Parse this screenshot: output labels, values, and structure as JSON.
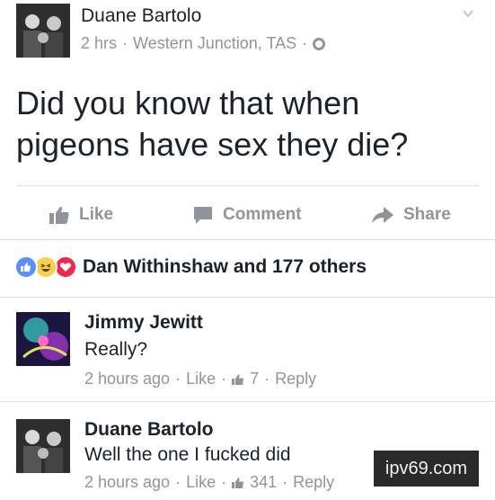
{
  "post": {
    "author": "Duane Bartolo",
    "time": "2 hrs",
    "location": "Western Junction, TAS",
    "sep": "·",
    "text_line1": "Did you know that when",
    "text_line2": "pigeons have sex they die?"
  },
  "actions": {
    "like": "Like",
    "comment": "Comment",
    "share": "Share"
  },
  "reactions": {
    "summary": "Dan Withinshaw and 177 others",
    "icons": [
      "like-reaction-icon",
      "haha-reaction-icon",
      "love-reaction-icon"
    ]
  },
  "comments": [
    {
      "author": "Jimmy Jewitt",
      "text": "Really?",
      "time": "2 hours ago",
      "like": "Like",
      "likes": "7",
      "reply": "Reply"
    },
    {
      "author": "Duane Bartolo",
      "text": "Well the one I fucked did",
      "time": "2 hours ago",
      "like": "Like",
      "likes": "341",
      "reply": "Reply"
    }
  ],
  "watermark": "ipv69.com",
  "colors": {
    "text": "#1d2129",
    "muted": "#90949c",
    "divider": "#dddfe2",
    "like_blue": "#5890ff",
    "haha_yellow": "#f7d14a",
    "love_red": "#f0284a"
  }
}
